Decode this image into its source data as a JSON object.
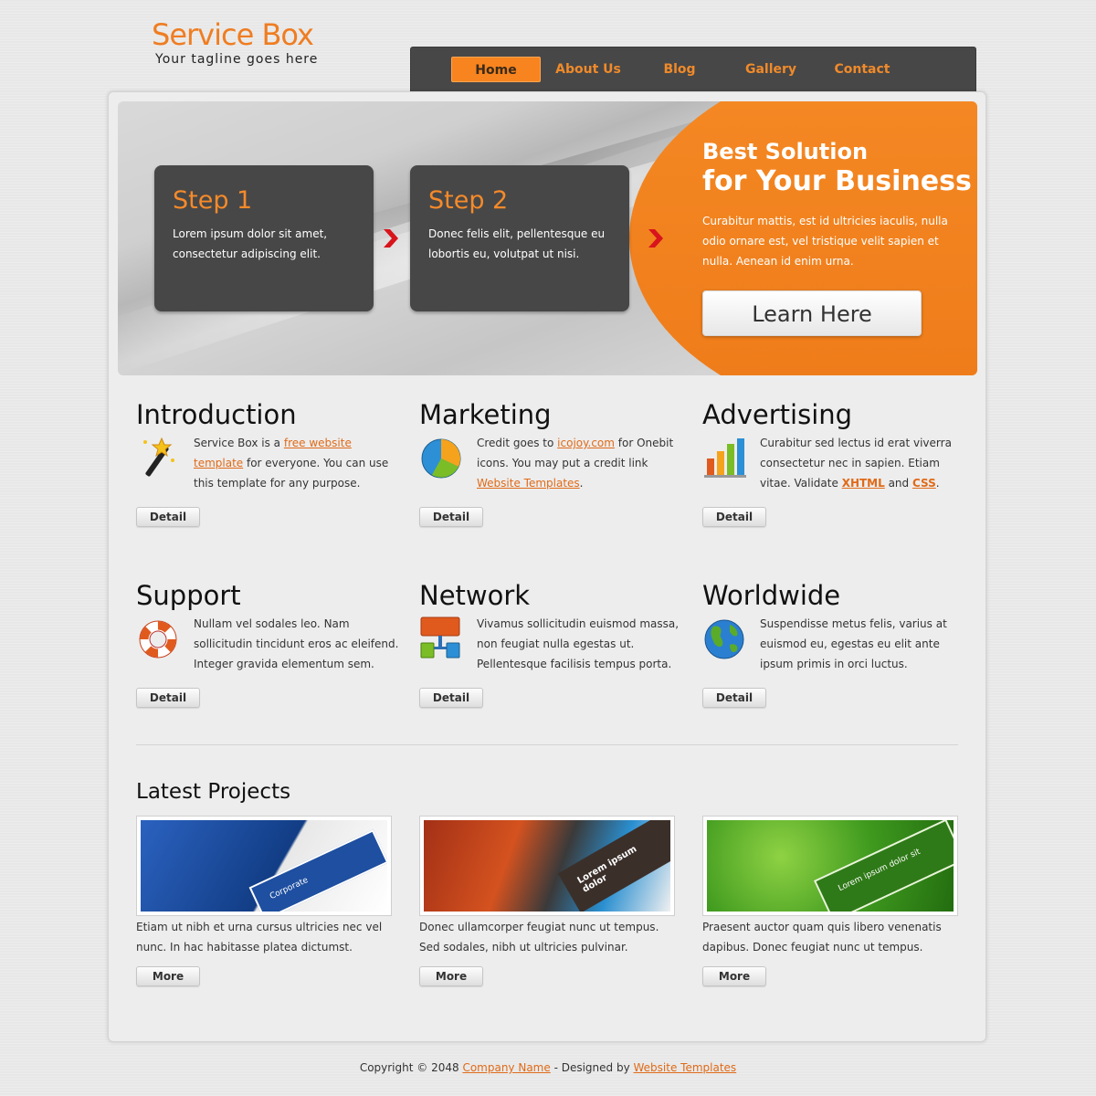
{
  "header": {
    "logo_title": "Service Box",
    "tagline": "Your tagline goes here"
  },
  "nav": {
    "items": [
      {
        "label": "Home",
        "active": true
      },
      {
        "label": "About Us",
        "active": false
      },
      {
        "label": "Blog",
        "active": false
      },
      {
        "label": "Gallery",
        "active": false
      },
      {
        "label": "Contact",
        "active": false
      }
    ]
  },
  "banner": {
    "steps": [
      {
        "title": "Step 1",
        "text": "Lorem ipsum dolor sit amet, consectetur adipiscing elit."
      },
      {
        "title": "Step 2",
        "text": "Donec felis elit, pellentesque eu lobortis eu, volutpat ut nisi."
      }
    ],
    "promo_line1": "Best Solution",
    "promo_line2": "for Your Business",
    "promo_text": "Curabitur mattis, est id ultricies iaculis, nulla odio ornare est, vel tristique velit sapien et nulla. Aenean id enim urna.",
    "cta_label": "Learn Here"
  },
  "features": [
    {
      "title": "Introduction",
      "icon": "magic-wand-icon",
      "text_before": "Service Box is a ",
      "link1": "free website template",
      "text_after": " for everyone. You can use this template for any purpose.",
      "button": "Detail"
    },
    {
      "title": "Marketing",
      "icon": "pie-chart-icon",
      "text_before": "Credit goes to ",
      "link1": "icojoy.com",
      "text_mid": " for Onebit icons. You may put a credit link ",
      "link2": "Website Templates",
      "text_after": ".",
      "button": "Detail"
    },
    {
      "title": "Advertising",
      "icon": "bar-chart-icon",
      "text_before": "Curabitur sed lectus id erat viverra consectetur nec in sapien. Etiam vitae. Validate ",
      "link1": "XHTML",
      "text_mid": " and ",
      "link2": "CSS",
      "text_after": ".",
      "button": "Detail"
    },
    {
      "title": "Support",
      "icon": "lifebuoy-icon",
      "text": "Nullam vel sodales leo. Nam sollicitudin tincidunt eros ac eleifend. Integer gravida elementum sem.",
      "button": "Detail"
    },
    {
      "title": "Network",
      "icon": "network-icon",
      "text": "Vivamus sollicitudin euismod massa, non feugiat nulla egestas ut. Pellentesque facilisis tempus porta.",
      "button": "Detail"
    },
    {
      "title": "Worldwide",
      "icon": "globe-icon",
      "text": "Suspendisse metus felis, varius at euismod eu, egestas eu elit ante ipsum primis in orci luctus.",
      "button": "Detail"
    }
  ],
  "latest": {
    "title": "Latest Projects",
    "projects": [
      {
        "text": "Etiam ut nibh et urna cursus ultricies nec vel nunc. In hac habitasse platea dictumst.",
        "button": "More",
        "thumb_color": "#1d4a9e",
        "thumb_label": "Corporate"
      },
      {
        "text": "Donec ullamcorper feugiat nunc ut tempus. Sed sodales, nibh ut ultricies pulvinar.",
        "button": "More",
        "thumb_color": "#c0441a",
        "thumb_label": "Lorem ipsum dolor"
      },
      {
        "text": "Praesent auctor quam quis libero venenatis dapibus. Donec feugiat nunc ut tempus.",
        "button": "More",
        "thumb_color": "#3f9a1e",
        "thumb_label": "Lorem ipsum dolor sit"
      }
    ]
  },
  "footer": {
    "copyright": "Copyright © 2048 ",
    "company_link": "Company Name",
    "designed_by": " - Designed by ",
    "templates_link": "Website Templates"
  },
  "colors": {
    "accent": "#f58a25",
    "nav_bg": "#474747",
    "link": "#e06a17"
  }
}
